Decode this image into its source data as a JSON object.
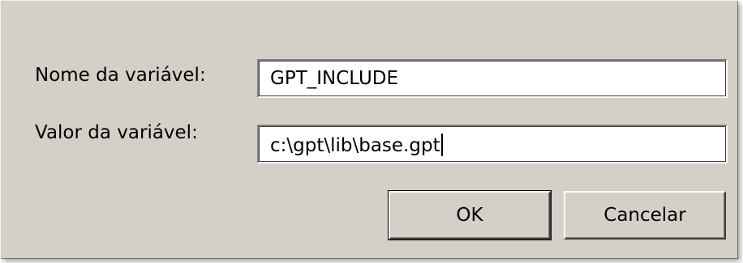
{
  "dialog": {
    "name_label": "Nome da variável:",
    "name_value": "GPT_INCLUDE",
    "value_label": "Valor da variável:",
    "value_value": "c:\\gpt\\lib\\base.gpt",
    "ok_label": "OK",
    "cancel_label": "Cancelar"
  },
  "colors": {
    "dialog_background": "#d4d0c8",
    "field_background": "#ffffff"
  }
}
